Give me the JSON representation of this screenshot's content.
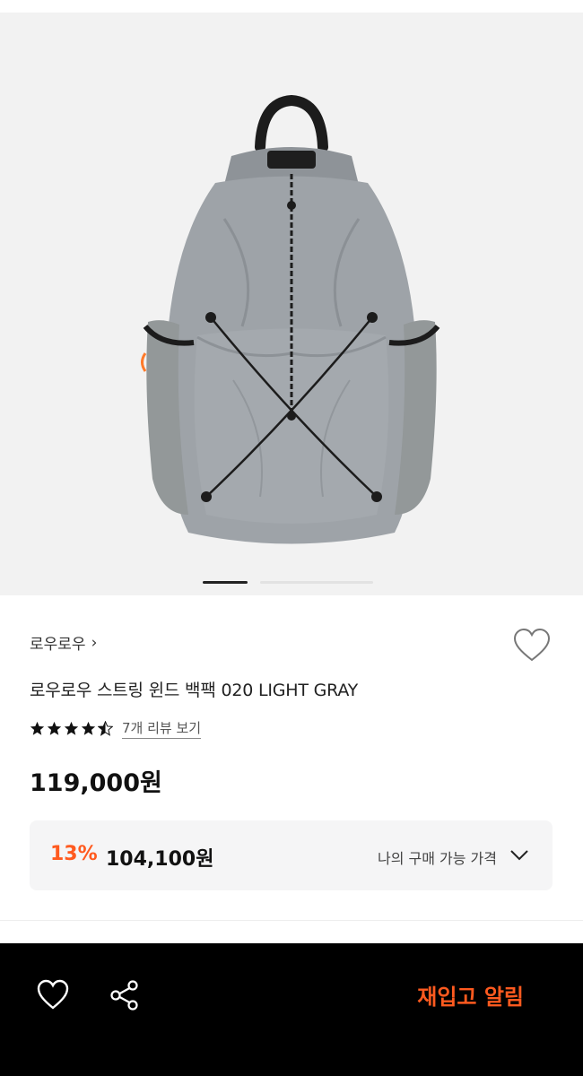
{
  "product": {
    "brand": "로우로우",
    "title": "로우로우 스트링 윈드 백팩 020 LIGHT GRAY",
    "rating": 4.5,
    "review_link": "7개 리뷰 보기",
    "price": "119,000원"
  },
  "discount": {
    "rate": "13%",
    "price": "104,100원",
    "my_price_label": "나의 구매 가능 가격"
  },
  "gallery": {
    "current_index": 1,
    "total_slides": 2
  },
  "bottom_bar": {
    "restock_button": "재입고 알림"
  },
  "colors": {
    "accent": "#ff5a1f",
    "bar_bg": "#000000",
    "box_bg": "#f5f5f6",
    "product_gray": "#9ea3a8"
  },
  "icons": [
    "chevron-right-icon",
    "heart-icon",
    "star-icon",
    "chevron-down-icon",
    "share-icon"
  ]
}
